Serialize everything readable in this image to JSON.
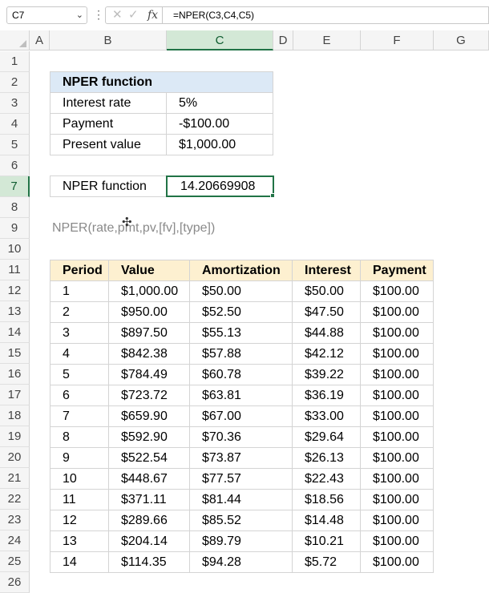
{
  "formula_bar": {
    "name_box": "C7",
    "kebab": "⋮",
    "cancel": "✕",
    "enter": "✓",
    "fx": "fx",
    "formula": "=NPER(C3,C4,C5)"
  },
  "columns": [
    "A",
    "B",
    "C",
    "D",
    "E",
    "F",
    "G"
  ],
  "selected_column": "C",
  "rows": [
    "1",
    "2",
    "3",
    "4",
    "5",
    "6",
    "7",
    "8",
    "9",
    "10",
    "11",
    "12",
    "13",
    "14",
    "15",
    "16",
    "17",
    "18",
    "19",
    "20",
    "21",
    "22",
    "23",
    "24",
    "25",
    "26"
  ],
  "selected_row": "7",
  "input_table": {
    "title": "NPER function",
    "rows": [
      {
        "label": "Interest rate",
        "value": "5%"
      },
      {
        "label": "Payment",
        "value": "-$100.00"
      },
      {
        "label": "Present value",
        "value": "$1,000.00"
      }
    ]
  },
  "result": {
    "label": "NPER function",
    "value": "14.20669908"
  },
  "syntax_hint": "NPER(rate,pmt,pv,[fv],[type])",
  "schedule": {
    "headers": [
      "Period",
      "Value",
      "Amortization",
      "Interest",
      "Payment"
    ],
    "rows": [
      [
        "1",
        "$1,000.00",
        "$50.00",
        "$50.00",
        "$100.00"
      ],
      [
        "2",
        "$950.00",
        "$52.50",
        "$47.50",
        "$100.00"
      ],
      [
        "3",
        "$897.50",
        "$55.13",
        "$44.88",
        "$100.00"
      ],
      [
        "4",
        "$842.38",
        "$57.88",
        "$42.12",
        "$100.00"
      ],
      [
        "5",
        "$784.49",
        "$60.78",
        "$39.22",
        "$100.00"
      ],
      [
        "6",
        "$723.72",
        "$63.81",
        "$36.19",
        "$100.00"
      ],
      [
        "7",
        "$659.90",
        "$67.00",
        "$33.00",
        "$100.00"
      ],
      [
        "8",
        "$592.90",
        "$70.36",
        "$29.64",
        "$100.00"
      ],
      [
        "9",
        "$522.54",
        "$73.87",
        "$26.13",
        "$100.00"
      ],
      [
        "10",
        "$448.67",
        "$77.57",
        "$22.43",
        "$100.00"
      ],
      [
        "11",
        "$371.11",
        "$81.44",
        "$18.56",
        "$100.00"
      ],
      [
        "12",
        "$289.66",
        "$85.52",
        "$14.48",
        "$100.00"
      ],
      [
        "13",
        "$204.14",
        "$89.79",
        "$10.21",
        "$100.00"
      ],
      [
        "14",
        "$114.35",
        "$94.28",
        "$5.72",
        "$100.00"
      ]
    ]
  },
  "colors": {
    "accent": "#217346",
    "title_fill": "#dce9f6",
    "header_fill": "#fdf0d0"
  }
}
